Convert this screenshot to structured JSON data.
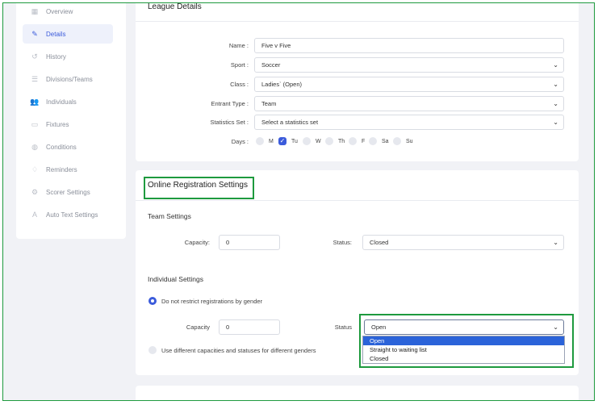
{
  "sidebar": {
    "items": [
      {
        "label": "Overview",
        "icon": "grid-icon"
      },
      {
        "label": "Details",
        "icon": "pencil-icon",
        "active": true
      },
      {
        "label": "History",
        "icon": "history-icon"
      },
      {
        "label": "Divisions/Teams",
        "icon": "list-icon"
      },
      {
        "label": "Individuals",
        "icon": "users-icon"
      },
      {
        "label": "Fixtures",
        "icon": "calendar-icon"
      },
      {
        "label": "Conditions",
        "icon": "globe-icon"
      },
      {
        "label": "Reminders",
        "icon": "bell-icon"
      },
      {
        "label": "Scorer Settings",
        "icon": "gears-icon"
      },
      {
        "label": "Auto Text Settings",
        "icon": "text-icon"
      }
    ]
  },
  "league": {
    "title": "League Details",
    "name_label": "Name :",
    "name_value": "Five v Five",
    "sport_label": "Sport :",
    "sport_value": "Soccer",
    "class_label": "Class :",
    "class_value": "Ladies` (Open)",
    "entrant_label": "Entrant Type :",
    "entrant_value": "Team",
    "stats_label": "Statistics Set :",
    "stats_value": "Select a statistics set",
    "days_label": "Days :",
    "days": [
      {
        "label": "M",
        "checked": false
      },
      {
        "label": "Tu",
        "checked": true
      },
      {
        "label": "W",
        "checked": false
      },
      {
        "label": "Th",
        "checked": false
      },
      {
        "label": "F",
        "checked": false
      },
      {
        "label": "Sa",
        "checked": false
      },
      {
        "label": "Su",
        "checked": false
      }
    ]
  },
  "registration": {
    "title": "Online Registration Settings",
    "team_title": "Team Settings",
    "team_capacity_label": "Capacity:",
    "team_capacity_value": "0",
    "team_status_label": "Status:",
    "team_status_value": "Closed",
    "individual_title": "Individual Settings",
    "radio_no_restrict": "Do not restrict registrations by gender",
    "ind_capacity_label": "Capacity",
    "ind_capacity_value": "0",
    "ind_status_label": "Status",
    "ind_status_value": "Open",
    "radio_different": "Use different capacities and statuses for different genders",
    "status_options": [
      "Open",
      "Straight to waiting list",
      "Closed"
    ]
  },
  "colors": {
    "accent": "#3b5bdb",
    "highlight_box": "#1e9a3e",
    "dropdown_selected": "#2b63d9"
  }
}
